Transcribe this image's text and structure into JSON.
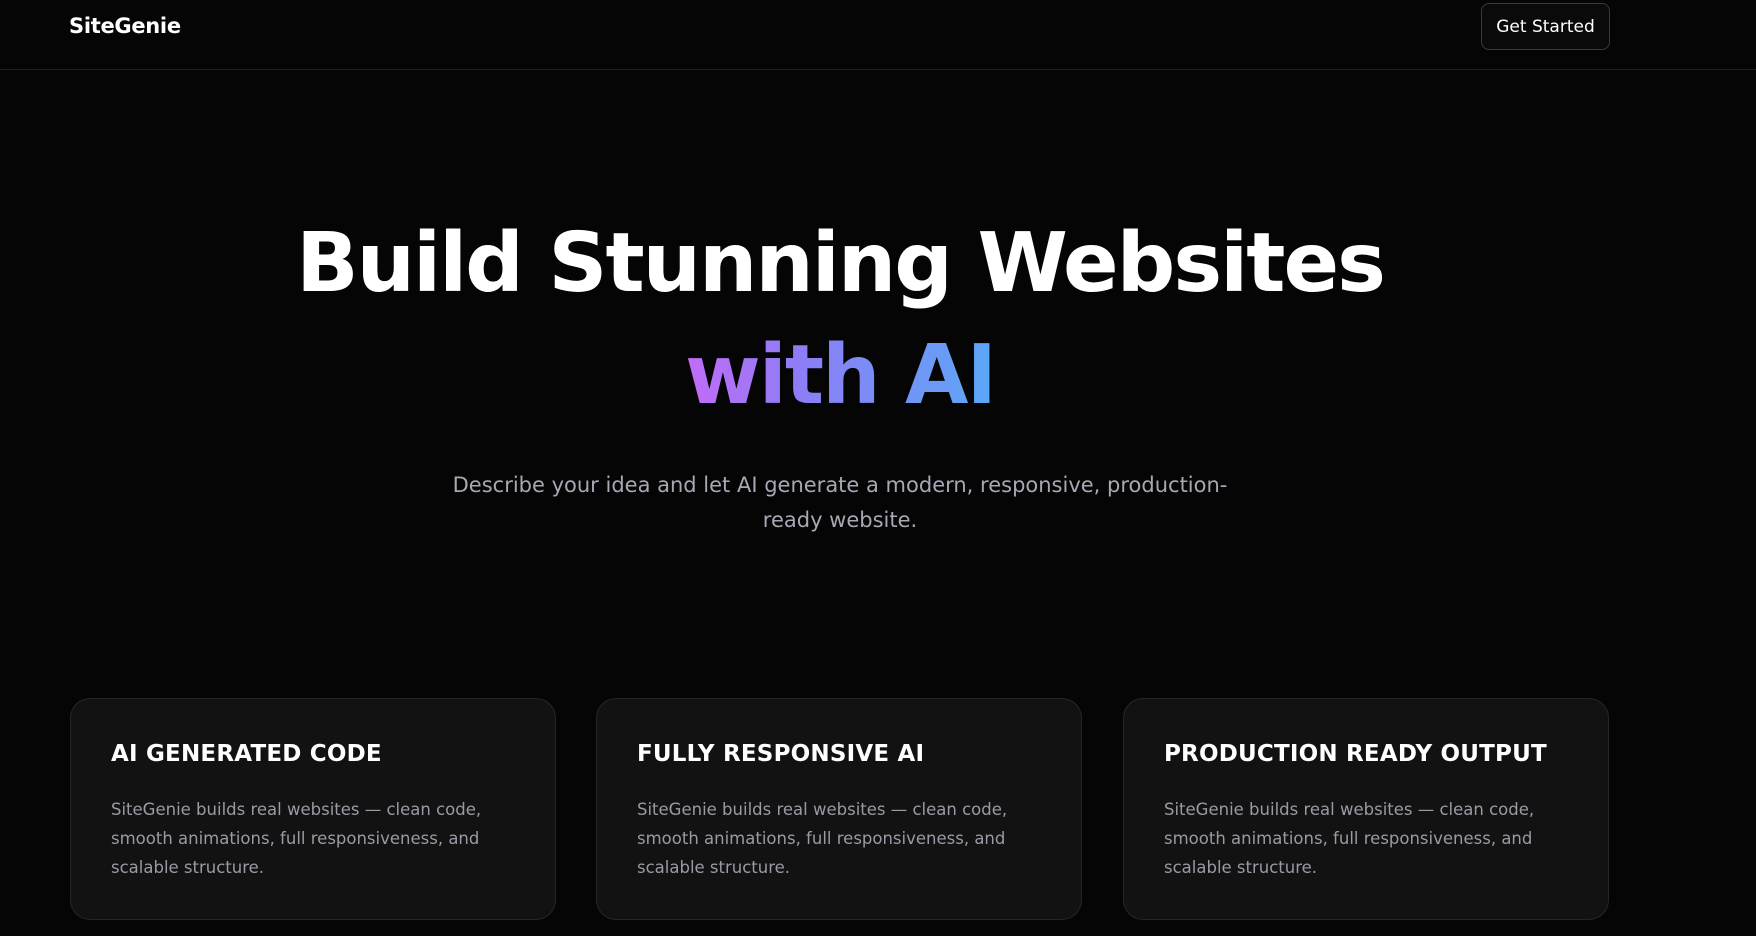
{
  "nav": {
    "brand": "SiteGenie",
    "cta_label": "Get Started"
  },
  "hero": {
    "title_line1": "Build Stunning Websites",
    "title_line2": "with AI",
    "subtitle": "Describe your idea and let AI generate a modern, responsive, production-ready website."
  },
  "features": [
    {
      "title": "AI GENERATED CODE",
      "description": "SiteGenie builds real websites — clean code, smooth animations, full responsiveness, and scalable structure."
    },
    {
      "title": "FULLY RESPONSIVE AI",
      "description": "SiteGenie builds real websites — clean code, smooth animations, full responsiveness, and scalable structure."
    },
    {
      "title": "PRODUCTION READY OUTPUT",
      "description": "SiteGenie builds real websites — clean code, smooth animations, full responsiveness, and scalable structure."
    }
  ],
  "colors": {
    "background": "#050505",
    "gradient_start": "#c26cf7",
    "gradient_end": "#5ba7f6",
    "muted_text": "#a7a7b5",
    "card_background": "#121212"
  }
}
